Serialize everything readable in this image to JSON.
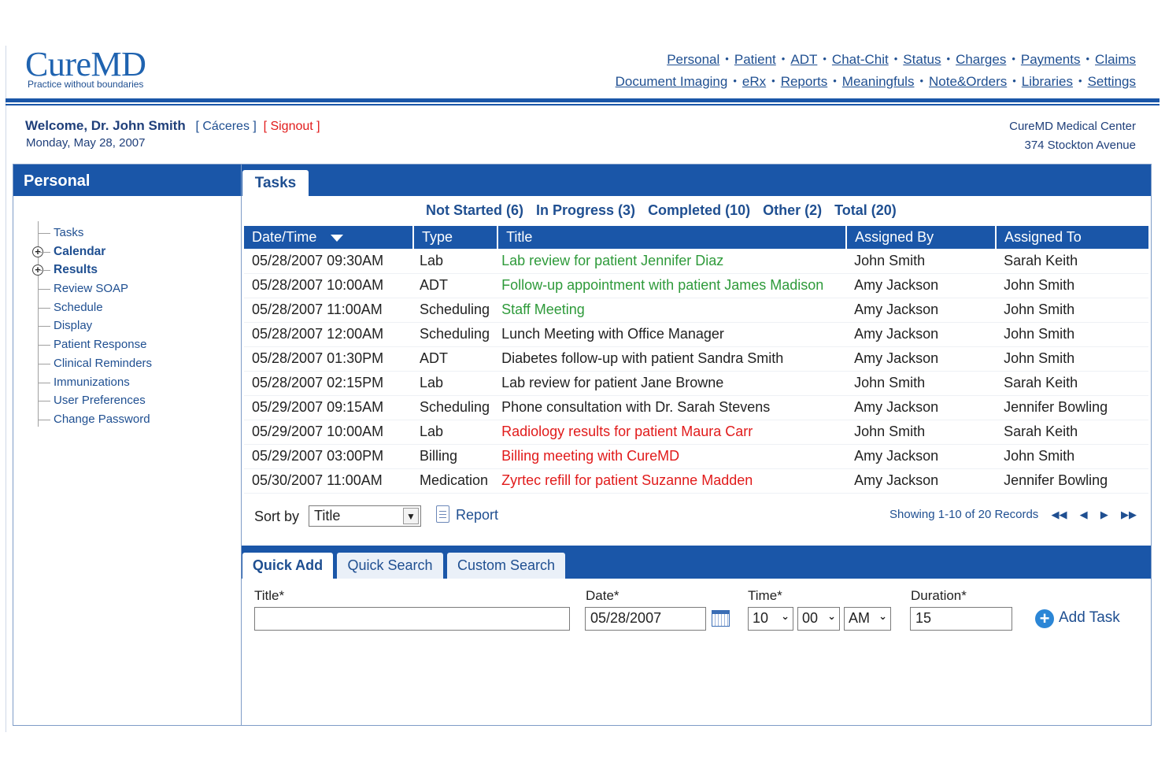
{
  "brand": {
    "logo": "CureMD",
    "tagline": "Practice without boundaries"
  },
  "top_nav": {
    "row1": [
      "Personal",
      "Patient",
      "ADT",
      "Chat-Chit",
      "Status",
      "Charges",
      "Payments",
      "Claims"
    ],
    "row2": [
      "Document Imaging",
      "eRx",
      "Reports",
      "Meaningfuls",
      "Note&Orders",
      "Libraries",
      "Settings"
    ]
  },
  "welcome": {
    "name": "Welcome, Dr. John Smith",
    "location": "[ Cáceres ]",
    "signout": "[ Signout ]",
    "date": "Monday, May 28, 2007"
  },
  "center": {
    "name": "CureMD Medical Center",
    "address": "374 Stockton Avenue"
  },
  "sidebar": {
    "title": "Personal",
    "items": [
      {
        "label": "Tasks",
        "bold": false,
        "expandable": false
      },
      {
        "label": "Calendar",
        "bold": true,
        "expandable": true
      },
      {
        "label": "Results",
        "bold": true,
        "expandable": true
      },
      {
        "label": "Review SOAP",
        "bold": false,
        "expandable": false
      },
      {
        "label": "Schedule",
        "bold": false,
        "expandable": false
      },
      {
        "label": "Display",
        "bold": false,
        "expandable": false
      },
      {
        "label": "Patient Response",
        "bold": false,
        "expandable": false
      },
      {
        "label": "Clinical Reminders",
        "bold": false,
        "expandable": false
      },
      {
        "label": "Immunizations",
        "bold": false,
        "expandable": false
      },
      {
        "label": "User Preferences",
        "bold": false,
        "expandable": false
      },
      {
        "label": "Change Password",
        "bold": false,
        "expandable": false
      }
    ]
  },
  "main": {
    "tab": "Tasks",
    "filters": [
      "Not Started (6)",
      "In Progress (3)",
      "Completed (10)",
      "Other (2)",
      "Total (20)"
    ],
    "columns": [
      "Date/Time",
      "Type",
      "Title",
      "Assigned By",
      "Assigned To"
    ],
    "rows": [
      {
        "datetime": "05/28/2007 09:30AM",
        "type": "Lab",
        "title": "Lab review for patient Jennifer Diaz",
        "title_color": "green",
        "by": "John Smith",
        "to": "Sarah Keith"
      },
      {
        "datetime": "05/28/2007 10:00AM",
        "type": "ADT",
        "title": "Follow-up appointment with patient James Madison",
        "title_color": "green",
        "by": "Amy Jackson",
        "to": "John Smith"
      },
      {
        "datetime": "05/28/2007 11:00AM",
        "type": "Scheduling",
        "title": "Staff Meeting",
        "title_color": "green",
        "by": "Amy Jackson",
        "to": "John Smith"
      },
      {
        "datetime": "05/28/2007 12:00AM",
        "type": "Scheduling",
        "title": "Lunch Meeting with Office Manager",
        "title_color": "black",
        "by": "Amy Jackson",
        "to": "John Smith"
      },
      {
        "datetime": "05/28/2007 01:30PM",
        "type": "ADT",
        "title": "Diabetes follow-up with patient Sandra Smith",
        "title_color": "black",
        "by": "Amy Jackson",
        "to": "John Smith"
      },
      {
        "datetime": "05/28/2007 02:15PM",
        "type": "Lab",
        "title": "Lab review for patient Jane Browne",
        "title_color": "black",
        "by": "John Smith",
        "to": "Sarah Keith"
      },
      {
        "datetime": "05/29/2007 09:15AM",
        "type": "Scheduling",
        "title": "Phone consultation with Dr. Sarah Stevens",
        "title_color": "black",
        "by": "Amy Jackson",
        "to": "Jennifer Bowling"
      },
      {
        "datetime": "05/29/2007 10:00AM",
        "type": "Lab",
        "title": "Radiology results for patient Maura Carr",
        "title_color": "red",
        "by": "John Smith",
        "to": "Sarah Keith"
      },
      {
        "datetime": "05/29/2007 03:00PM",
        "type": "Billing",
        "title": "Billing meeting with CureMD",
        "title_color": "red",
        "by": "Amy Jackson",
        "to": "John Smith"
      },
      {
        "datetime": "05/30/2007 11:00AM",
        "type": "Medication",
        "title": "Zyrtec refill for patient Suzanne Madden",
        "title_color": "red",
        "by": "Amy Jackson",
        "to": "Jennifer Bowling"
      }
    ],
    "sort_by_label": "Sort by",
    "sort_by_value": "Title",
    "report_label": "Report",
    "showing": "Showing 1-10 of 20 Records"
  },
  "quick": {
    "tabs": [
      "Quick Add",
      "Quick Search",
      "Custom Search"
    ],
    "title_label": "Title*",
    "title_value": "",
    "date_label": "Date*",
    "date_value": "05/28/2007",
    "time_label": "Time*",
    "hour": "10",
    "minute": "00",
    "ampm": "AM",
    "duration_label": "Duration*",
    "duration_value": "15",
    "add_label": "Add Task"
  },
  "colors": {
    "primary": "#1a56a8",
    "link": "#1f4f91",
    "green": "#2e9a3a",
    "red": "#e11b1b"
  }
}
